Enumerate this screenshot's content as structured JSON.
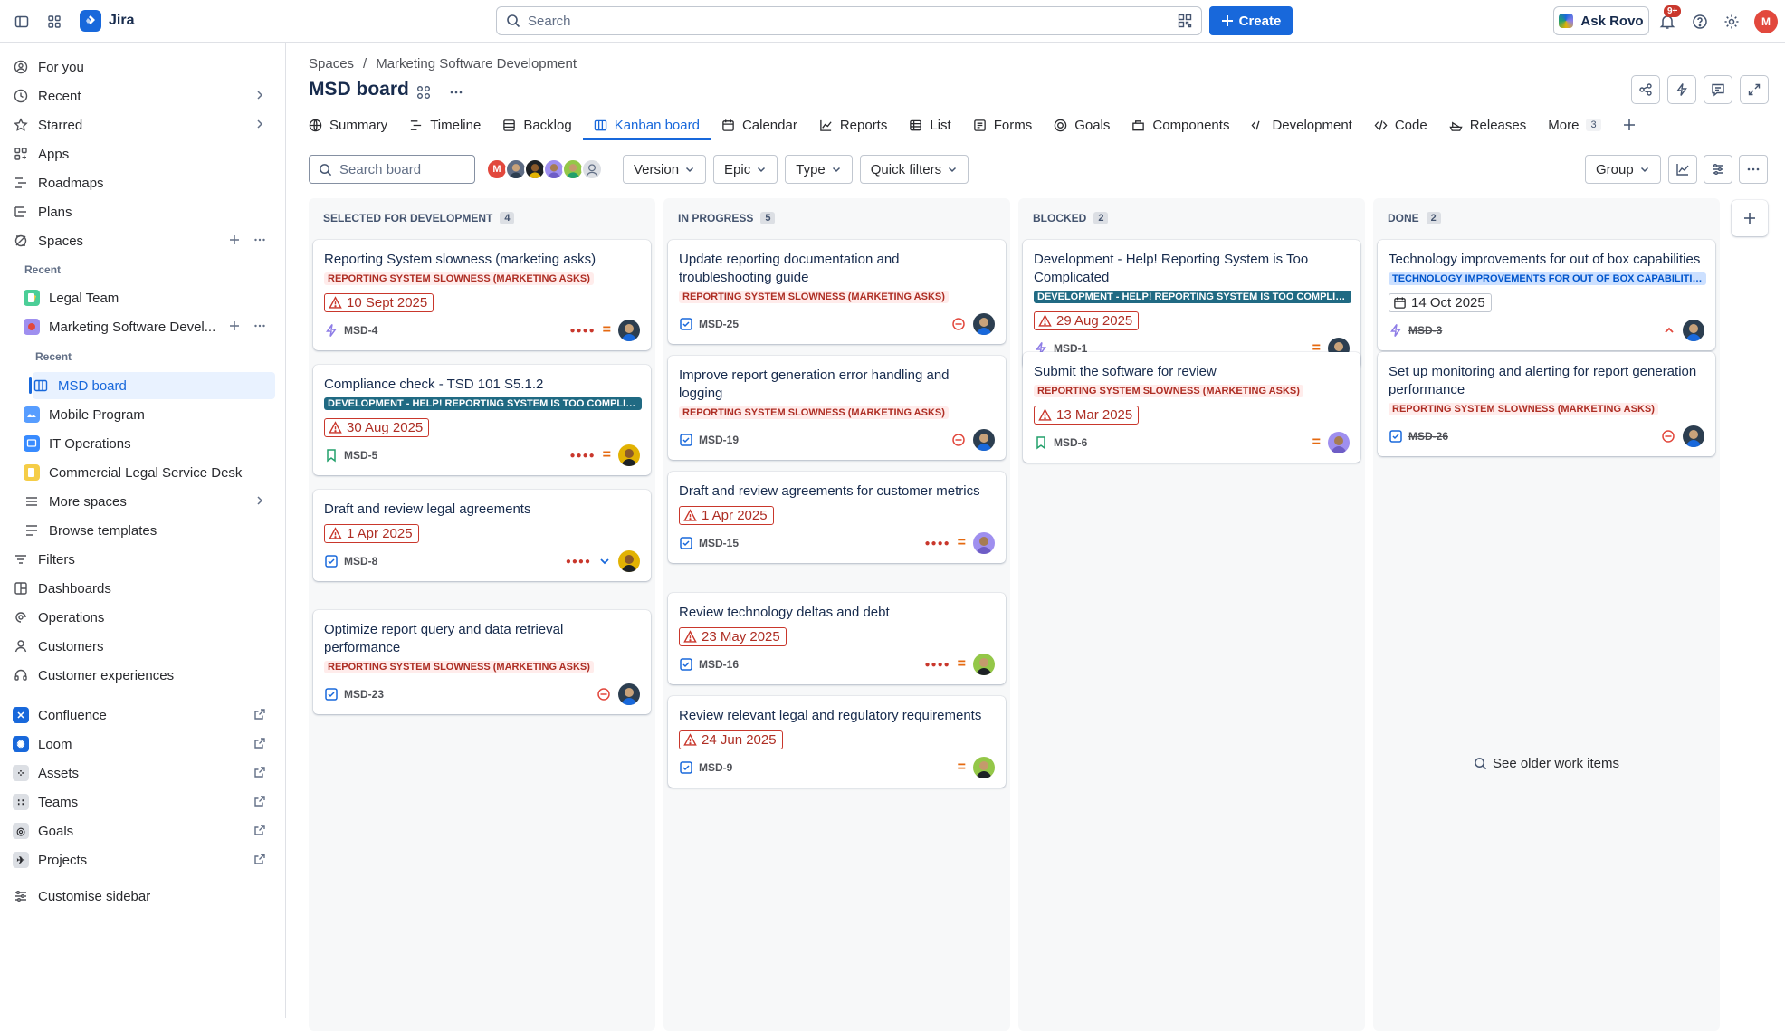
{
  "app": {
    "name": "Jira"
  },
  "topbar": {
    "search_placeholder": "Search",
    "create_label": "Create",
    "rovo_label": "Ask Rovo",
    "notif_count": "9+",
    "user_initial": "M"
  },
  "sidebar": {
    "items": [
      {
        "label": "For you"
      },
      {
        "label": "Recent"
      },
      {
        "label": "Starred"
      },
      {
        "label": "Apps"
      },
      {
        "label": "Roadmaps"
      },
      {
        "label": "Plans"
      },
      {
        "label": "Spaces"
      }
    ],
    "recent_head": "Recent",
    "spaces": [
      {
        "label": "Legal Team"
      },
      {
        "label": "Marketing Software Devel..."
      }
    ],
    "sub_recent_head": "Recent",
    "board_item": "MSD board",
    "more_spaces": [
      {
        "label": "Mobile Program"
      },
      {
        "label": "IT Operations"
      },
      {
        "label": "Commercial Legal Service Desk"
      },
      {
        "label": "More spaces"
      },
      {
        "label": "Browse templates"
      }
    ],
    "bottom": [
      {
        "label": "Filters"
      },
      {
        "label": "Dashboards"
      },
      {
        "label": "Operations"
      },
      {
        "label": "Customers"
      },
      {
        "label": "Customer experiences"
      }
    ],
    "apps": [
      {
        "label": "Confluence"
      },
      {
        "label": "Loom"
      },
      {
        "label": "Assets"
      },
      {
        "label": "Teams"
      },
      {
        "label": "Goals"
      },
      {
        "label": "Projects"
      }
    ],
    "customise": "Customise sidebar"
  },
  "breadcrumb": {
    "root": "Spaces",
    "sep": "/",
    "project": "Marketing Software Development"
  },
  "page_title": "MSD board",
  "tabs": [
    {
      "label": "Summary"
    },
    {
      "label": "Timeline"
    },
    {
      "label": "Backlog"
    },
    {
      "label": "Kanban board"
    },
    {
      "label": "Calendar"
    },
    {
      "label": "Reports"
    },
    {
      "label": "List"
    },
    {
      "label": "Forms"
    },
    {
      "label": "Goals"
    },
    {
      "label": "Components"
    },
    {
      "label": "Development"
    },
    {
      "label": "Code"
    },
    {
      "label": "Releases"
    },
    {
      "label": "More",
      "count": "3"
    }
  ],
  "toolbar": {
    "search_placeholder": "Search board",
    "filters": [
      "Version",
      "Epic",
      "Type",
      "Quick filters"
    ],
    "group_label": "Group",
    "avatar_initial": "M"
  },
  "columns": [
    {
      "name": "SELECTED FOR DEVELOPMENT",
      "count": "4",
      "cards": [
        {
          "title": "Reporting System slowness (marketing asks)",
          "label": "REPORTING SYSTEM SLOWNESS (MARKETING ASKS)",
          "due": "10 Sept 2025",
          "key": "MSD-4"
        },
        {
          "title": "Compliance check - TSD 101 S5.1.2",
          "label": "DEVELOPMENT - HELP! REPORTING SYSTEM IS TOO COMPLICATED",
          "due": "30 Aug 2025",
          "key": "MSD-5"
        },
        {
          "title": "Draft and review legal agreements",
          "due": "1 Apr 2025",
          "key": "MSD-8"
        },
        {
          "title": "Optimize report query and data retrieval performance",
          "label": "REPORTING SYSTEM SLOWNESS (MARKETING ASKS)",
          "key": "MSD-23"
        }
      ]
    },
    {
      "name": "IN PROGRESS",
      "count": "5",
      "cards": [
        {
          "title": "Update reporting documentation and troubleshooting guide",
          "label": "REPORTING SYSTEM SLOWNESS (MARKETING ASKS)",
          "key": "MSD-25"
        },
        {
          "title": "Improve report generation error handling and logging",
          "label": "REPORTING SYSTEM SLOWNESS (MARKETING ASKS)",
          "key": "MSD-19"
        },
        {
          "title": "Draft and review agreements for customer metrics",
          "due": "1 Apr 2025",
          "key": "MSD-15"
        },
        {
          "title": "Review technology deltas and debt",
          "due": "23 May 2025",
          "key": "MSD-16"
        },
        {
          "title": "Review relevant legal and regulatory requirements",
          "due": "24 Jun 2025",
          "key": "MSD-9"
        }
      ]
    },
    {
      "name": "BLOCKED",
      "count": "2",
      "cards": [
        {
          "title": "Development - Help! Reporting System is Too Complicated",
          "label": "DEVELOPMENT - HELP! REPORTING SYSTEM IS TOO COMPLICATED",
          "due": "29 Aug 2025",
          "key": "MSD-1"
        },
        {
          "title": "Submit the software for review",
          "label": "REPORTING SYSTEM SLOWNESS (MARKETING ASKS)",
          "due": "13 Mar 2025",
          "key": "MSD-6"
        }
      ]
    },
    {
      "name": "DONE",
      "count": "2",
      "cards": [
        {
          "title": "Technology improvements for out of box capabilities",
          "label": "TECHNOLOGY IMPROVEMENTS FOR OUT OF BOX CAPABILITIES",
          "due": "14 Oct 2025",
          "key": "MSD-3"
        },
        {
          "title": "Set up monitoring and alerting for report generation performance",
          "label": "REPORTING SYSTEM SLOWNESS (MARKETING ASKS)",
          "key": "MSD-26"
        }
      ],
      "older_link": "See older work items"
    }
  ],
  "colors": {
    "accent": "#1868db",
    "danger": "#c9372c",
    "medium": "#e56910",
    "teal_label": "#206a83"
  }
}
